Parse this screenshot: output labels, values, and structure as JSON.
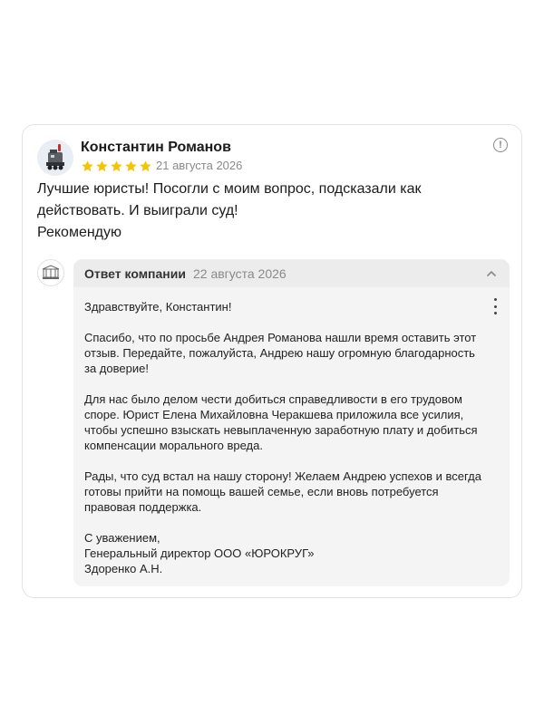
{
  "review": {
    "author": "Константин Романов",
    "rating": 5,
    "date": "21 августа 2026",
    "text_lines": [
      "Лучшие юристы! Посогли с моим вопрос, подсказали как",
      "действовать. И выиграли суд!",
      "Рекомендую"
    ],
    "report_icon": "exclamation-circle-icon",
    "star_color": "#f5c400"
  },
  "reply": {
    "title": "Ответ компании",
    "date": "22 августа 2026",
    "collapse_icon": "chevron-up-icon",
    "more_icon": "kebab-menu-icon",
    "paragraphs": [
      [
        "Здравствуйте, Константин!"
      ],
      [
        "Спасибо, что по просьбе Андрея Романова нашли время оставить этот",
        "отзыв. Передайте, пожалуйста, Андрею нашу огромную благодарность",
        "за доверие!"
      ],
      [
        "Для нас было делом чести добиться справедливости в его трудовом",
        "споре. Юрист Елена Михайловна Черакшева приложила все усилия,",
        "чтобы успешно взыскать невыплаченную заработную плату и добиться",
        "компенсации морального вреда."
      ],
      [
        "Рады, что суд встал на нашу сторону! Желаем Андрею успехов и всегда",
        "готовы прийти на помощь вашей семье, если вновь потребуется",
        "правовая поддержка."
      ],
      [
        "С уважением,",
        "Генеральный директор ООО «ЮРОКРУГ»",
        "Здоренко А.Н."
      ]
    ]
  }
}
